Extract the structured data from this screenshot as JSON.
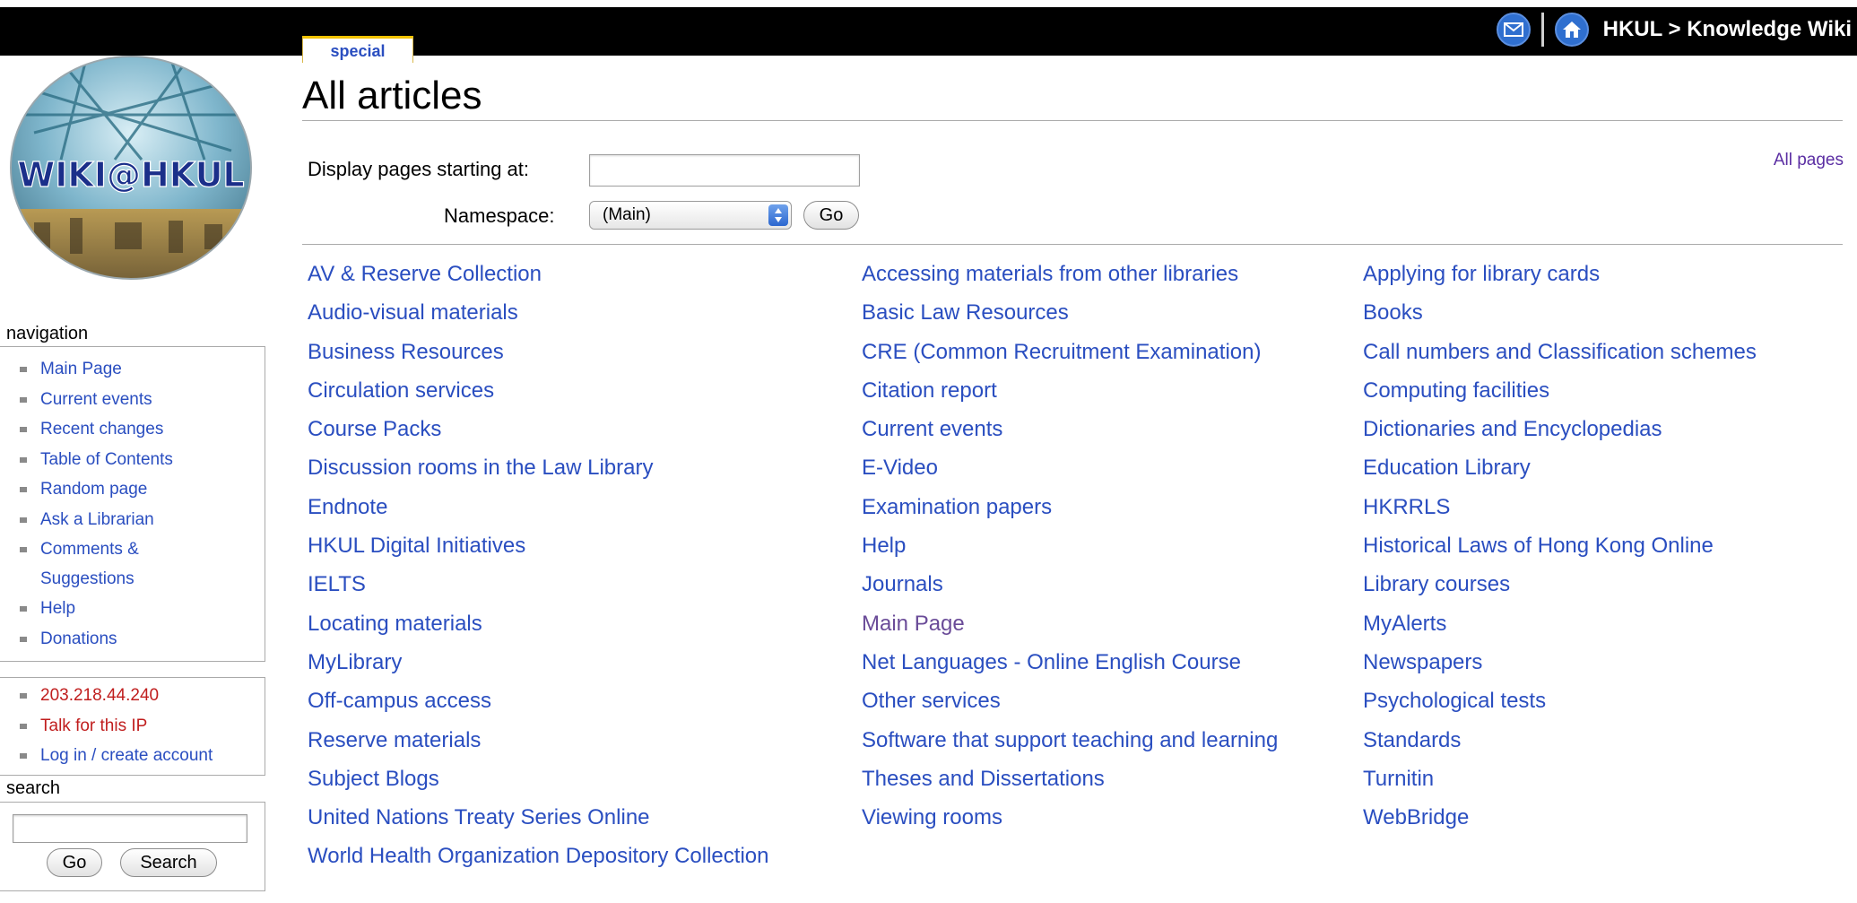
{
  "header": {
    "site_path": "HKUL > Knowledge Wiki",
    "mail_icon": "mail-icon",
    "home_icon": "home-icon"
  },
  "tabs": [
    {
      "label": "special"
    }
  ],
  "sidebar": {
    "logo_text": "WIKI@HKUL",
    "navigation_title": "navigation",
    "navigation_items": [
      {
        "label": "Main Page"
      },
      {
        "label": "Current events"
      },
      {
        "label": "Recent changes"
      },
      {
        "label": "Table of Contents"
      },
      {
        "label": "Random page"
      },
      {
        "label": "Ask a Librarian"
      },
      {
        "label": "Comments &"
      },
      {
        "label": "Suggestions"
      },
      {
        "label": "Help"
      },
      {
        "label": "Donations"
      }
    ],
    "personal_items": [
      {
        "label": "203.218.44.240"
      },
      {
        "label": "Talk for this IP"
      },
      {
        "label": "Log in / create account"
      }
    ],
    "search_title": "search",
    "search_go_label": "Go",
    "search_search_label": "Search",
    "search_value": ""
  },
  "main": {
    "title": "All articles",
    "display_from_label": "Display pages starting at:",
    "display_from_value": "",
    "namespace_label": "Namespace:",
    "namespace_selected": "(Main)",
    "go_label": "Go",
    "all_pages_link": "All pages",
    "columns": [
      [
        "AV & Reserve Collection",
        "Audio-visual materials",
        "Business Resources",
        "Circulation services",
        "Course Packs",
        "Discussion rooms in the Law Library",
        "Endnote",
        "HKUL Digital Initiatives",
        "IELTS",
        "Locating materials",
        "MyLibrary",
        "Off-campus access",
        "Reserve materials",
        "Subject Blogs",
        "United Nations Treaty Series Online",
        "World Health Organization Depository Collection"
      ],
      [
        "Accessing materials from other libraries",
        "Basic Law Resources",
        "CRE (Common Recruitment Examination)",
        "Citation report",
        "Current events",
        "E-Video",
        "Examination papers",
        "Help",
        "Journals",
        "Main Page",
        "Net Languages - Online English Course",
        "Other services",
        "Software that support teaching and learning",
        "Theses and Dissertations",
        "Viewing rooms"
      ],
      [
        "Applying for library cards",
        "Books",
        "Call numbers and Classification schemes",
        "Computing facilities",
        "Dictionaries and Encyclopedias",
        "Education Library",
        "HKRRLS",
        "Historical Laws of Hong Kong Online",
        "Library courses",
        "MyAlerts",
        "Newspapers",
        "Psychological tests",
        "Standards",
        "Turnitin",
        "WebBridge"
      ]
    ],
    "visited_links": [
      "Main Page"
    ]
  },
  "colors": {
    "link": "#2a4ec0",
    "visited_link": "#6a4b98",
    "anon_link": "#c01e1e",
    "topbar": "#000000",
    "tab_accent": "#f2c200"
  }
}
